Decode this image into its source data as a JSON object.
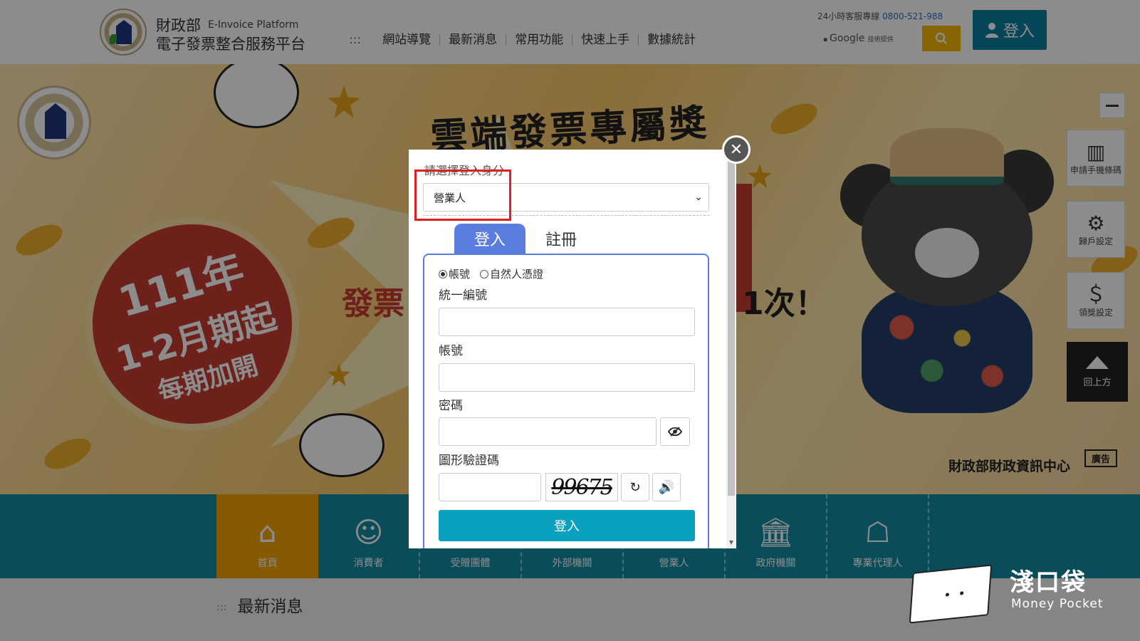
{
  "header": {
    "org_name": "財政部",
    "org_name_en": "E-Invoice Platform",
    "platform_name": "電子發票整合服務平台",
    "nav_dots": ":::",
    "nav_items": [
      "網站導覽",
      "最新消息",
      "常用功能",
      "快速上手",
      "數據統計"
    ],
    "hotline_label": "24小時客服專線",
    "hotline_number": "0800-521-988",
    "search_provider": "Google",
    "search_provider_suffix": "技術提供",
    "login_label": "登入"
  },
  "banner": {
    "title": "雲端發票專屬獎",
    "badge_line1": "111年",
    "badge_line2": "1-2月期起",
    "badge_line3": "每期加開",
    "left_fragment": "發票",
    "right_fragment": "1次！",
    "agency": "財政部財政資訊中心",
    "ad_label": "廣告"
  },
  "side_tools": [
    {
      "icon": "barcode-plus-icon",
      "label": "申請手機條碼"
    },
    {
      "icon": "account-settings-icon",
      "label": "歸戶設定"
    },
    {
      "icon": "payout-settings-icon",
      "label": "領獎設定"
    }
  ],
  "back_to_top_label": "回上方",
  "categories": [
    {
      "icon": "home-icon",
      "label": "首頁",
      "active": true
    },
    {
      "icon": "consumer-icon",
      "label": "消費者",
      "active": false
    },
    {
      "icon": "group-icon",
      "label": "受贈團體",
      "active": false
    },
    {
      "icon": "agency-icon",
      "label": "外部機關",
      "active": false
    },
    {
      "icon": "business-icon",
      "label": "營業人",
      "active": false
    },
    {
      "icon": "government-icon",
      "label": "政府機關",
      "active": false
    },
    {
      "icon": "agent-icon",
      "label": "專業代理人",
      "active": false
    }
  ],
  "news": {
    "dots": ":::",
    "title": "最新消息"
  },
  "login_modal": {
    "role_label": "請選擇登入身分",
    "role_selected": "營業人",
    "tabs": [
      "登入",
      "註冊"
    ],
    "active_tab": "登入",
    "radio_account": "帳號",
    "radio_certificate": "自然人憑證",
    "radio_selected": "帳號",
    "field_tax_id_label": "統一編號",
    "field_tax_id_value": "",
    "field_account_label": "帳號",
    "field_account_value": "",
    "field_password_label": "密碼",
    "field_password_value": "",
    "field_captcha_label": "圖形驗證碼",
    "field_captcha_value": "",
    "captcha_text": "99675",
    "submit_label": "登入"
  },
  "watermark": {
    "brand_zh": "淺口袋",
    "brand_en": "Money Pocket"
  },
  "colors": {
    "login_button": "#0e7fa3",
    "search_button": "#f6b800",
    "category_bar": "#118aa5",
    "category_active": "#f5a500",
    "tab_active": "#5b7ddf",
    "submit": "#0aa0bf",
    "highlight": "#e02020"
  }
}
